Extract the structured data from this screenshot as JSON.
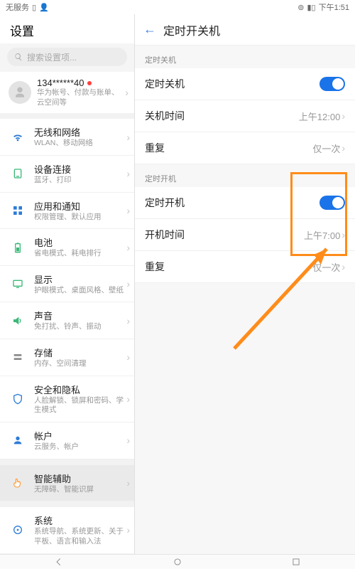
{
  "statusbar": {
    "carrier": "无服务",
    "time": "下午1:51"
  },
  "left": {
    "title": "设置",
    "search_placeholder": "搜索设置项...",
    "account": {
      "title": "134******40",
      "subtitle": "华为帐号、付款与账单、云空间等"
    },
    "groups": [
      [
        {
          "key": "wifi",
          "title": "无线和网络",
          "subtitle": "WLAN、移动网络",
          "color": "#2e7bd6",
          "icon": "wifi"
        },
        {
          "key": "device",
          "title": "设备连接",
          "subtitle": "蓝牙、打印",
          "color": "#3cb878",
          "icon": "device"
        },
        {
          "key": "apps",
          "title": "应用和通知",
          "subtitle": "权限管理、默认应用",
          "color": "#2e7bd6",
          "icon": "apps"
        },
        {
          "key": "battery",
          "title": "电池",
          "subtitle": "省电模式、耗电排行",
          "color": "#3cb878",
          "icon": "battery"
        },
        {
          "key": "display",
          "title": "显示",
          "subtitle": "护眼模式、桌面风格、壁纸",
          "color": "#3cb878",
          "icon": "display"
        },
        {
          "key": "sound",
          "title": "声音",
          "subtitle": "免打扰、铃声、振动",
          "color": "#3cb878",
          "icon": "sound"
        },
        {
          "key": "storage",
          "title": "存储",
          "subtitle": "内存、空间清理",
          "color": "#888888",
          "icon": "storage"
        },
        {
          "key": "security",
          "title": "安全和隐私",
          "subtitle": "人脸解锁、锁屏和密码、学生模式",
          "color": "#2e7bd6",
          "icon": "security"
        },
        {
          "key": "accounts",
          "title": "帐户",
          "subtitle": "云服务、帐户",
          "color": "#2e7bd6",
          "icon": "accounts"
        }
      ],
      [
        {
          "key": "smart",
          "title": "智能辅助",
          "subtitle": "无障碍、智能识屏",
          "color": "#ff8c1a",
          "icon": "hand",
          "active": true
        }
      ],
      [
        {
          "key": "system",
          "title": "系统",
          "subtitle": "系统导航、系统更新、关于平板、语言和输入法",
          "color": "#2e7bd6",
          "icon": "system"
        }
      ]
    ]
  },
  "right": {
    "title": "定时开关机",
    "sections": [
      {
        "label": "定时关机",
        "rows": [
          {
            "key": "off_toggle",
            "label": "定时关机",
            "type": "toggle",
            "on": true
          },
          {
            "key": "off_time",
            "label": "关机时间",
            "value": "上午12:00"
          },
          {
            "key": "off_repeat",
            "label": "重复",
            "value": "仅一次"
          }
        ]
      },
      {
        "label": "定时开机",
        "rows": [
          {
            "key": "on_toggle",
            "label": "定时开机",
            "type": "toggle",
            "on": true
          },
          {
            "key": "on_time",
            "label": "开机时间",
            "value": "上午7:00"
          },
          {
            "key": "on_repeat",
            "label": "重复",
            "value": "仅一次"
          }
        ]
      }
    ]
  }
}
